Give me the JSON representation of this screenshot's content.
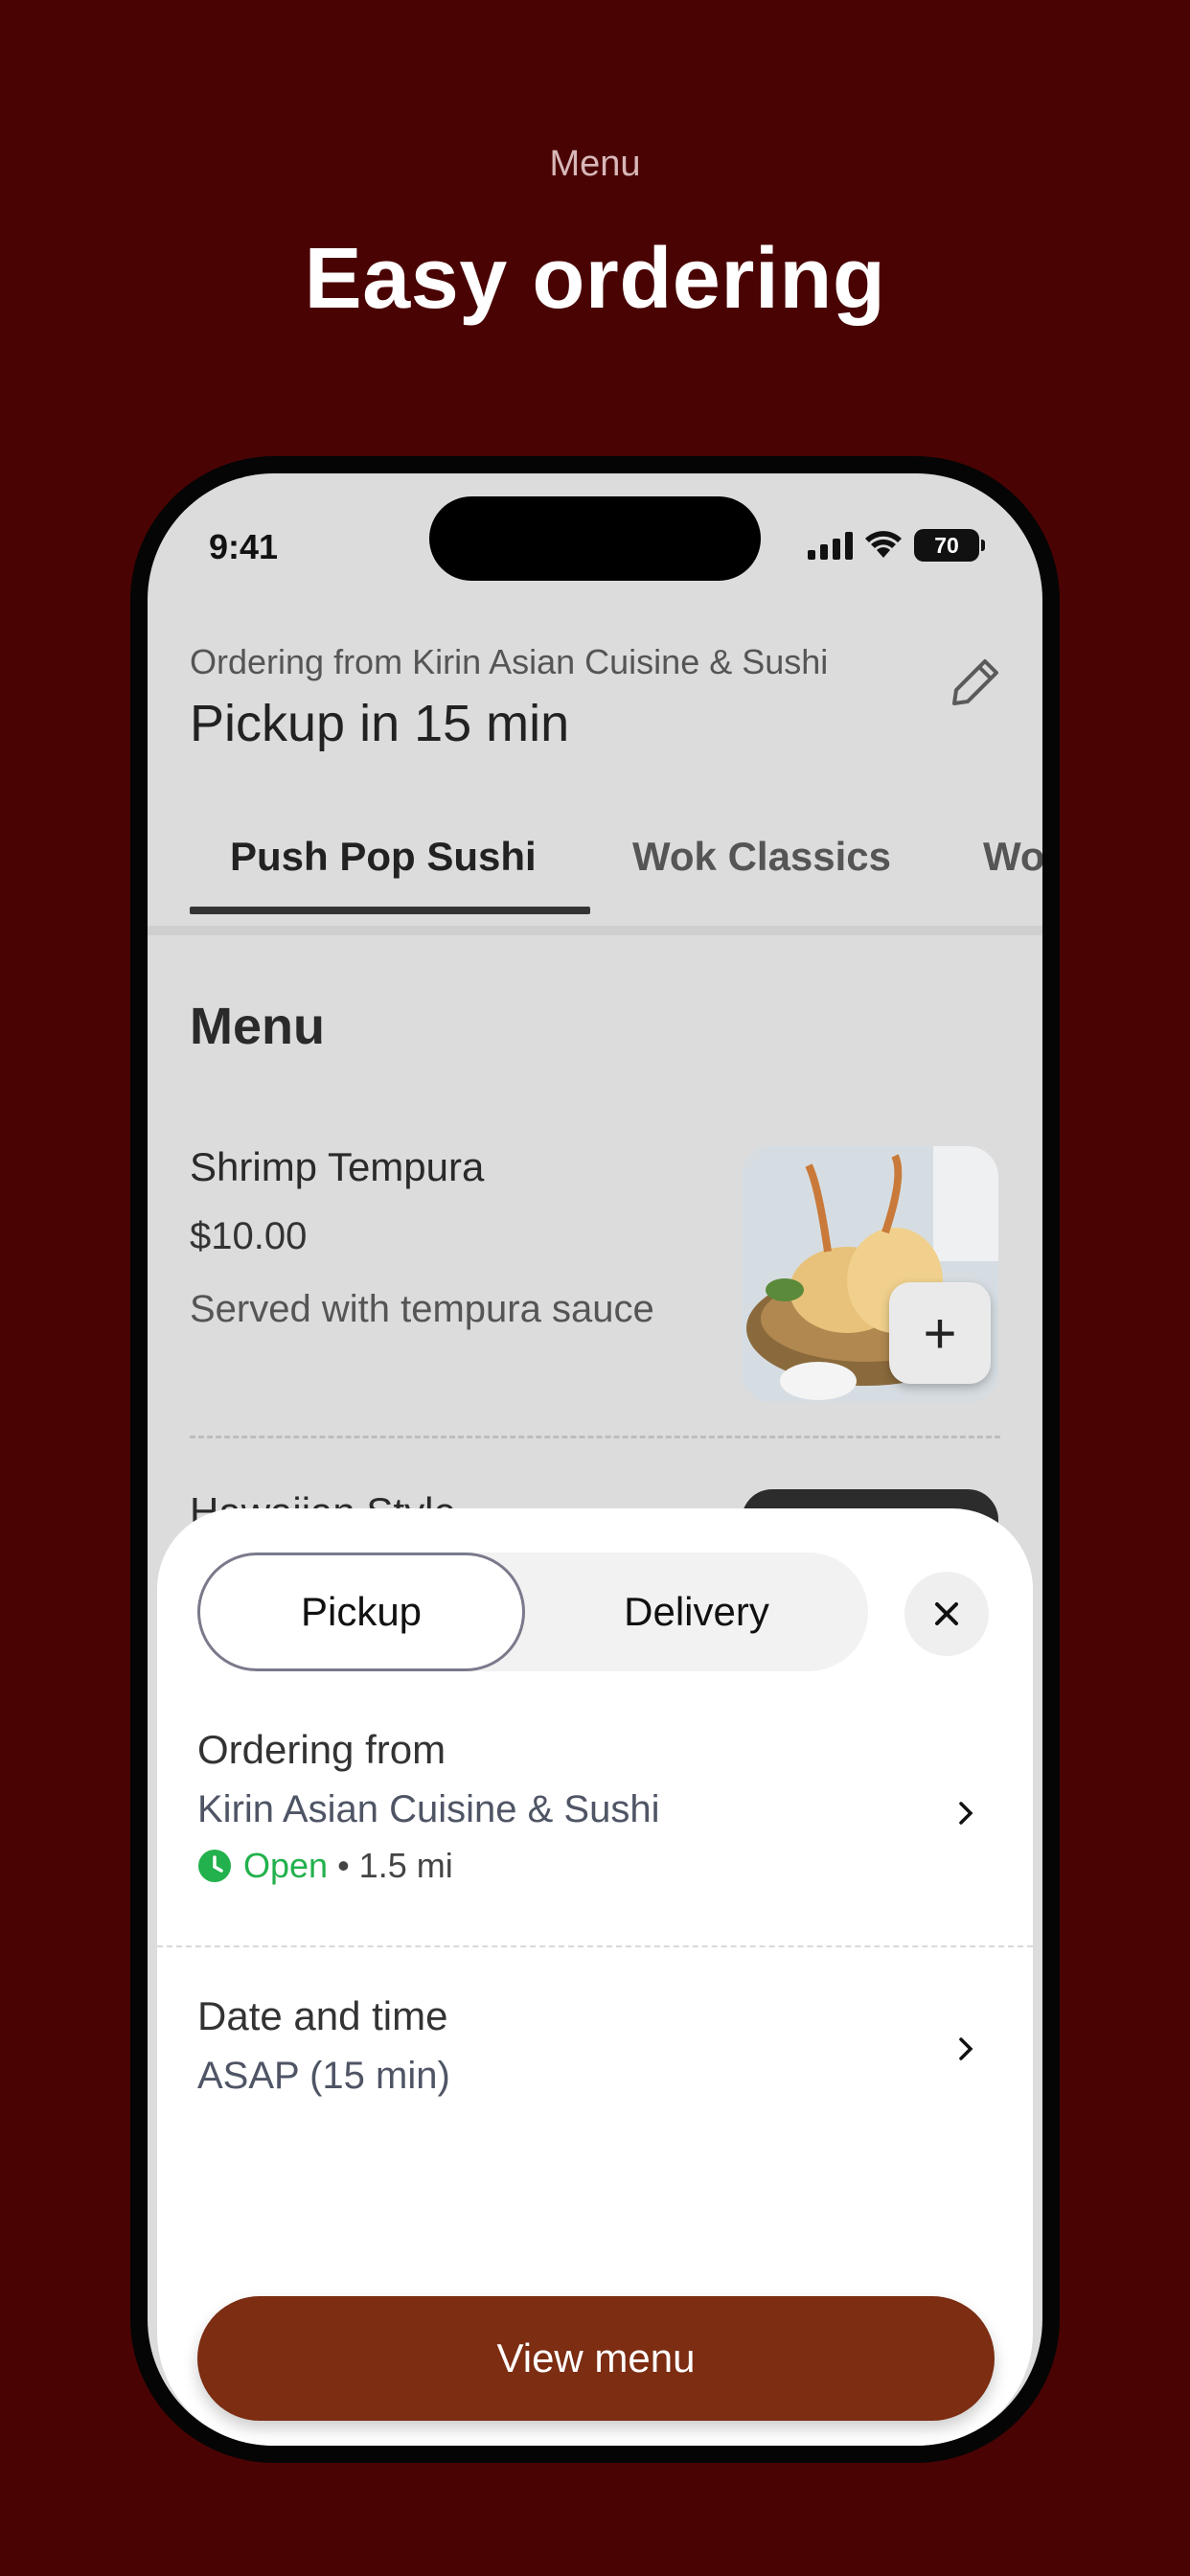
{
  "promo": {
    "subtitle": "Menu",
    "title": "Easy ordering"
  },
  "status_bar": {
    "time": "9:41",
    "battery": "70"
  },
  "header": {
    "ordering_from_label": "Ordering from Kirin Asian Cuisine & Sushi",
    "pickup_eta": "Pickup in 15 min",
    "edit_icon": "pencil-icon"
  },
  "tabs": [
    {
      "label": "Push Pop Sushi",
      "active": true
    },
    {
      "label": "Wok Classics",
      "active": false
    },
    {
      "label": "Wo",
      "active": false
    }
  ],
  "menu": {
    "section_title": "Menu",
    "items": [
      {
        "name": "Shrimp Tempura",
        "price": "$10.00",
        "description": "Served with tempura sauce",
        "add_label": "+"
      }
    ],
    "peek_item_name": "Hawaiian Style"
  },
  "sheet": {
    "mode_options": [
      "Pickup",
      "Delivery"
    ],
    "selected_mode": "Pickup",
    "close_icon": "close-icon",
    "ordering_from_title": "Ordering from",
    "restaurant_name": "Kirin Asian Cuisine & Sushi",
    "open_status": "Open",
    "distance": "• 1.5 mi",
    "date_time_title": "Date and time",
    "date_time_value": "ASAP (15 min)",
    "cta_label": "View menu"
  },
  "colors": {
    "background": "#4a0303",
    "accent": "#7c2d12",
    "open_green": "#22b14c"
  }
}
